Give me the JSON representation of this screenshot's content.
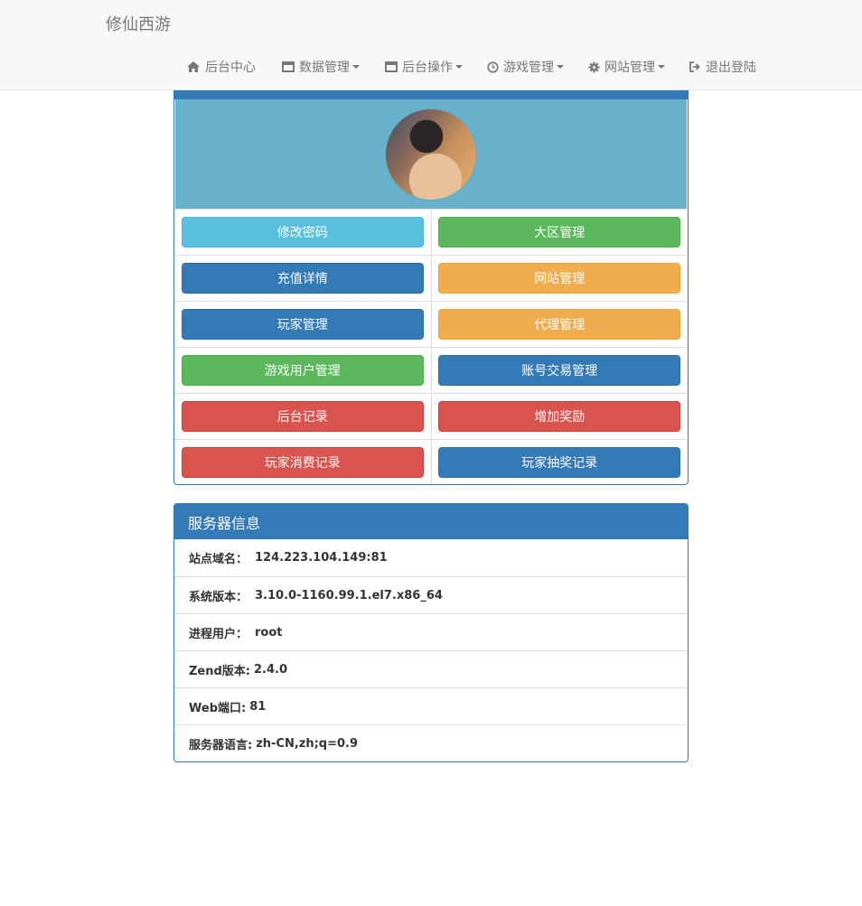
{
  "brand": "修仙西游",
  "nav": [
    {
      "icon": "home-icon",
      "label": "后台中心",
      "dropdown": false
    },
    {
      "icon": "window-icon",
      "label": "数据管理",
      "dropdown": true
    },
    {
      "icon": "window-icon",
      "label": "后台操作",
      "dropdown": true
    },
    {
      "icon": "clock-icon",
      "label": "游戏管理",
      "dropdown": true
    },
    {
      "icon": "gear-icon",
      "label": "网站管理",
      "dropdown": true
    },
    {
      "icon": "logout-icon",
      "label": "退出登陆",
      "dropdown": false
    }
  ],
  "buttons": [
    [
      {
        "label": "修改密码",
        "style": "info"
      },
      {
        "label": "大区管理",
        "style": "success"
      }
    ],
    [
      {
        "label": "充值详情",
        "style": "primary"
      },
      {
        "label": "网站管理",
        "style": "warning"
      }
    ],
    [
      {
        "label": "玩家管理",
        "style": "primary"
      },
      {
        "label": "代理管理",
        "style": "warning"
      }
    ],
    [
      {
        "label": "游戏用户管理",
        "style": "success"
      },
      {
        "label": "账号交易管理",
        "style": "primary"
      }
    ],
    [
      {
        "label": "后台记录",
        "style": "danger"
      },
      {
        "label": "增加奖励",
        "style": "danger"
      }
    ],
    [
      {
        "label": "玩家消费记录",
        "style": "danger"
      },
      {
        "label": "玩家抽奖记录",
        "style": "primary"
      }
    ]
  ],
  "server": {
    "title": "服务器信息",
    "items": [
      {
        "label": "站点域名：",
        "value": "124.223.104.149:81"
      },
      {
        "label": "系统版本：",
        "value": "3.10.0-1160.99.1.el7.x86_64"
      },
      {
        "label": "进程用户：",
        "value": "root"
      },
      {
        "label": "Zend版本:",
        "value": "2.4.0"
      },
      {
        "label": "Web端口:",
        "value": "81"
      },
      {
        "label": "服务器语言:",
        "value": "zh-CN,zh;q=0.9"
      }
    ]
  },
  "colors": {
    "primary": "#337ab7",
    "info": "#5bc0de",
    "success": "#5cb85c",
    "warning": "#f0ad4e",
    "danger": "#d9534f",
    "avatar_bg": "#67b1ca"
  }
}
